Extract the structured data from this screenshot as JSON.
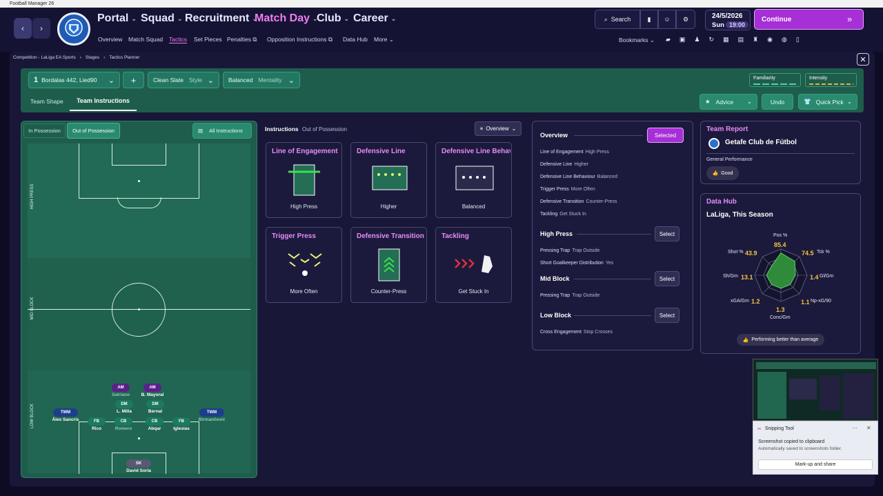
{
  "window": {
    "title": "Football Manager 26"
  },
  "nav": {
    "main": [
      "Portal",
      "Squad",
      "Recruitment",
      "Match Day",
      "Club",
      "Career"
    ],
    "sub": [
      "Overview",
      "Match Squad",
      "Tactics",
      "Set Pieces",
      "Penalties",
      "Opposition Instructions",
      "Data Hub",
      "More"
    ],
    "search_label": "Search",
    "date": "24/5/2026",
    "day": "Sun",
    "time": "19:00",
    "continue_label": "Continue",
    "bookmarks_label": "Bookmarks"
  },
  "breadcrumb": [
    "Competition - LaLiga EA Sports",
    "Stages",
    "Tactics Planner"
  ],
  "tactic": {
    "number": "1",
    "name": "Bordalas 442, Lied90",
    "style": "Clean Slate",
    "style_label": "Style",
    "mentality": "Balanced",
    "mentality_label": "Mentality",
    "add": "+",
    "familiarity": "Familiarity",
    "intensity": "Intensity"
  },
  "tabs": {
    "team_shape": "Team Shape",
    "team_instructions": "Team Instructions"
  },
  "actions": {
    "advice": "Advice",
    "undo": "Undo",
    "quick_pick": "Quick Pick"
  },
  "phase": {
    "in_possession": "In Possession",
    "out_of_possession": "Out of Possession",
    "all_instructions": "All Instructions"
  },
  "pitch_zones": [
    "HIGH PRESS",
    "MID BLOCK",
    "LOW BLOCK"
  ],
  "players": [
    {
      "pos": "AM",
      "name": "Satriano",
      "color": "#5b1f8a",
      "dim": true
    },
    {
      "pos": "AM",
      "name": "B. Mayoral",
      "color": "#5b1f8a",
      "dim": false
    },
    {
      "pos": "DM",
      "name": "L. Milla",
      "color": "#1b7a5f",
      "dim": false
    },
    {
      "pos": "DM",
      "name": "Bernal",
      "color": "#1b7a5f",
      "dim": false
    },
    {
      "pos": "TWM",
      "name": "Álex Sancris",
      "color": "#1c3f8c",
      "dim": false
    },
    {
      "pos": "TWM",
      "name": "Birmančević",
      "color": "#1c3f8c",
      "dim": true
    },
    {
      "pos": "FB",
      "name": "Rico",
      "color": "#1b7a5f",
      "dim": false
    },
    {
      "pos": "CB",
      "name": "Romero",
      "color": "#1b7a5f",
      "dim": true
    },
    {
      "pos": "CB",
      "name": "Abqar",
      "color": "#1b7a5f",
      "dim": false
    },
    {
      "pos": "FB",
      "name": "Iglesias",
      "color": "#1b7a5f",
      "dim": false
    },
    {
      "pos": "SK",
      "name": "David Soria",
      "color": "#5a5874",
      "dim": false
    }
  ],
  "instructions": {
    "title": "Instructions",
    "subtitle": "Out of Possession",
    "view": "Overview",
    "cards": [
      {
        "title": "Line of Engagement",
        "value": "High Press"
      },
      {
        "title": "Defensive Line",
        "value": "Higher"
      },
      {
        "title": "Defensive Line Behaviour",
        "value": "Balanced"
      },
      {
        "title": "Trigger Press",
        "value": "More Often"
      },
      {
        "title": "Defensive Transition",
        "value": "Counter-Press"
      },
      {
        "title": "Tackling",
        "value": "Get Stuck In"
      }
    ]
  },
  "overview": {
    "title": "Overview",
    "selected": "Selected",
    "items": [
      [
        "Line of Engagement",
        "High Press"
      ],
      [
        "Defensive Line",
        "Higher"
      ],
      [
        "Defensive Line Behaviour",
        "Balanced"
      ],
      [
        "Trigger Press",
        "More Often"
      ],
      [
        "Defensive Transition",
        "Counter-Press"
      ],
      [
        "Tackling",
        "Get Stuck In"
      ]
    ],
    "high_press": {
      "title": "High Press",
      "select": "Select",
      "items": [
        [
          "Pressing Trap",
          "Trap Outside"
        ],
        [
          "Short Goalkeeper Distribution",
          "Yes"
        ]
      ]
    },
    "mid_block": {
      "title": "Mid Block",
      "select": "Select",
      "items": [
        [
          "Pressing Trap",
          "Trap Outside"
        ]
      ]
    },
    "low_block": {
      "title": "Low Block",
      "select": "Select",
      "items": [
        [
          "Cross Engagement",
          "Stop Crosses"
        ]
      ]
    }
  },
  "team_report": {
    "title": "Team Report",
    "club": "Getafe Club de Fútbol",
    "perf_label": "General Performance",
    "perf_value": "Good"
  },
  "data_hub": {
    "title": "Data Hub",
    "subtitle": "LaLiga, This Season",
    "footer": "Performing better than average",
    "stats": [
      {
        "label": "Pos %",
        "value": "85.4"
      },
      {
        "label": "Tck %",
        "value": "74.5"
      },
      {
        "label": "Gl/Gm",
        "value": "1.4"
      },
      {
        "label": "Np-xG/90",
        "value": "1.1"
      },
      {
        "label": "Conc/Gm",
        "value": "1.3"
      },
      {
        "label": "xGA/Gm",
        "value": "1.2"
      },
      {
        "label": "Sh/Gm",
        "value": "13.1"
      },
      {
        "label": "Shot %",
        "value": "43.9"
      }
    ],
    "radar": [
      0.85,
      0.75,
      0.55,
      0.5,
      0.5,
      0.5,
      0.55,
      0.5
    ]
  },
  "snip": {
    "app": "Snipping Tool",
    "msg": "Screenshot copied to clipboard",
    "sub": "Automatically saved to screenshots folder.",
    "btn": "Mark-up and share"
  },
  "colors": {
    "accent": "#a62fd6",
    "green": "#1e5d4c",
    "purple_text": "#e58cf5"
  }
}
